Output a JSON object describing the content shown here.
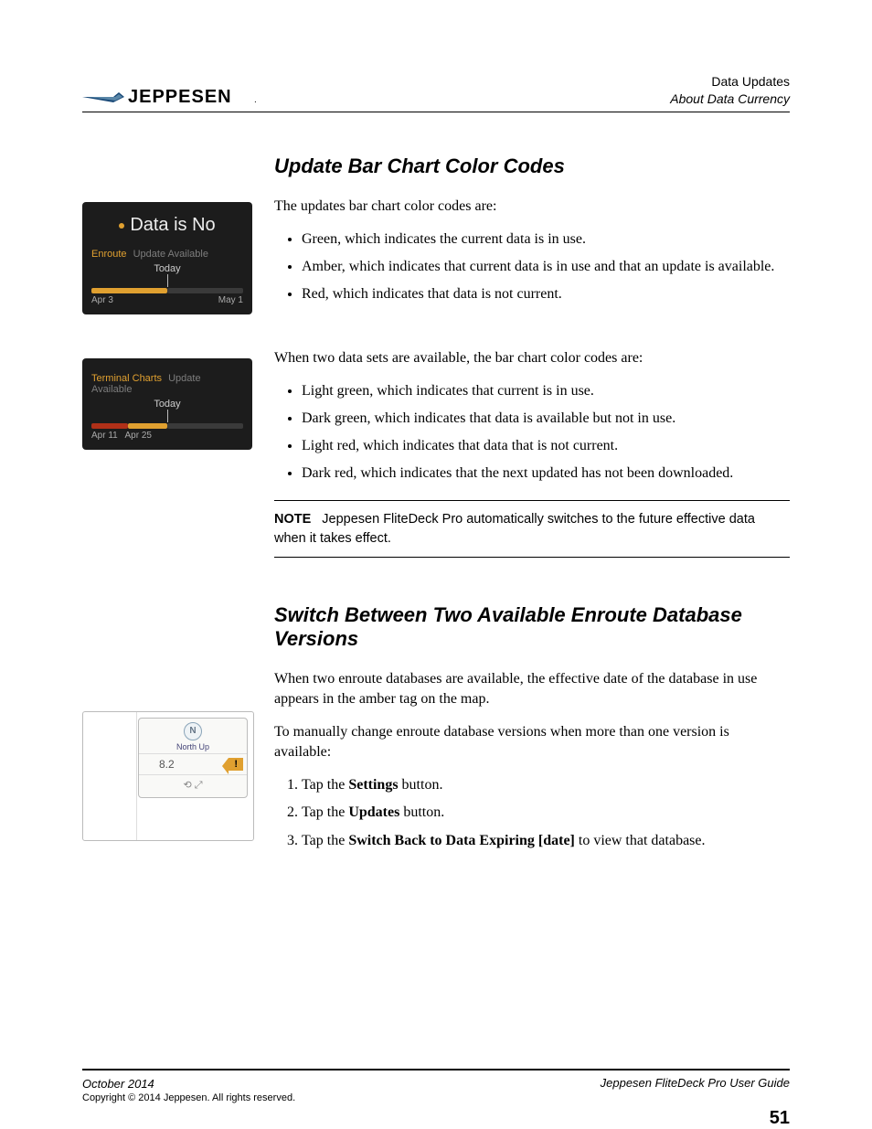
{
  "header": {
    "brand": "JEPPESEN",
    "right_line1": "Data Updates",
    "right_line2": "About Data Currency"
  },
  "section1": {
    "title": "Update Bar Chart Color Codes",
    "intro": "The updates bar chart color codes are:",
    "bullets1": [
      "Green, which indicates the current data is in use.",
      "Amber, which indicates that current data is in use and that an update is available.",
      "Red, which indicates that data is not current."
    ],
    "intro2": "When two data sets are available, the bar chart color codes are:",
    "bullets2": [
      "Light green, which indicates that current is in use.",
      "Dark green, which indicates that data is available but not in use.",
      "Light red, which indicates that data that is not current.",
      "Dark red, which indicates that the next updated has not been downloaded."
    ],
    "note_label": "NOTE",
    "note_text": "Jeppesen FliteDeck Pro automatically switches to the future effective data when it takes effect."
  },
  "widget1": {
    "title": "Data is No",
    "category": "Enroute",
    "status": "Update Available",
    "today": "Today",
    "label_left": "Apr 3",
    "label_right": "May 1"
  },
  "widget2": {
    "category": "Terminal Charts",
    "status": "Update Available",
    "today": "Today",
    "label_left": "Apr 11",
    "label_mid": "Apr 25"
  },
  "section2": {
    "title": "Switch Between Two Available Enroute Database Versions",
    "para1": "When two enroute databases are available, the effective date of the database in use appears in the amber tag on the map.",
    "para2": "To manually change enroute database versions when more than one version is available:",
    "step1_pre": "Tap the ",
    "step1_bold": "Settings",
    "step1_post": " button.",
    "step2_pre": "Tap the ",
    "step2_bold": "Updates",
    "step2_post": " button.",
    "step3_pre": "Tap the ",
    "step3_bold": "Switch Back to Data Expiring [date]",
    "step3_post": " to view that database."
  },
  "mapwidget": {
    "north_letter": "N",
    "north_label": "North Up",
    "range": "8.2",
    "tag": "!",
    "zoom_icon": "⟲ ⤢"
  },
  "footer": {
    "date": "October 2014",
    "copyright": "Copyright © 2014 Jeppesen. All rights reserved.",
    "guide": "Jeppesen FliteDeck Pro User Guide",
    "page": "51"
  }
}
